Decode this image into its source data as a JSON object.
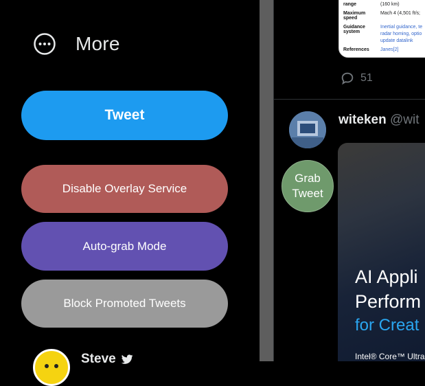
{
  "sidebar": {
    "more_label": "More",
    "tweet_button": "Tweet",
    "disable_overlay_button": "Disable Overlay Service",
    "autograb_button": "Auto-grab Mode",
    "block_promoted_button": "Block Promoted Tweets",
    "user_name": "Steve",
    "icons": {
      "more": "more-circle-icon",
      "bird": "twitter-bird-icon"
    }
  },
  "colors": {
    "tweet_button": "#1d9bf0",
    "disable_overlay": "#b05b58",
    "autograb": "#6251b1",
    "block_promoted": "#9a9a9a",
    "grab_tweet": "#6f9a6c"
  },
  "feed": {
    "wiki_card": {
      "rows": [
        {
          "key": "range",
          "value": "(160 km)",
          "link": false
        },
        {
          "key": "Maximum speed",
          "value": "Mach 4 (4,501 ft/s;",
          "link": false
        },
        {
          "key": "Guidance system",
          "value": "Inertial guidance, te",
          "link": true
        },
        {
          "key": "",
          "value": "radar homing, optio",
          "link": true
        },
        {
          "key": "",
          "value": "update datalink",
          "link": true
        },
        {
          "key": "References",
          "value": "Janes[2]",
          "link": true
        }
      ]
    },
    "reply_count": "51",
    "tweet": {
      "author_name": "witeken",
      "author_handle": "@wit",
      "grab_label_line1": "Grab",
      "grab_label_line2": "Tweet",
      "media": {
        "headline1": "AI Appli",
        "headline2": "Perform",
        "headline3": "for Creat",
        "footer": "Intel® Core™ Ultra"
      }
    }
  }
}
